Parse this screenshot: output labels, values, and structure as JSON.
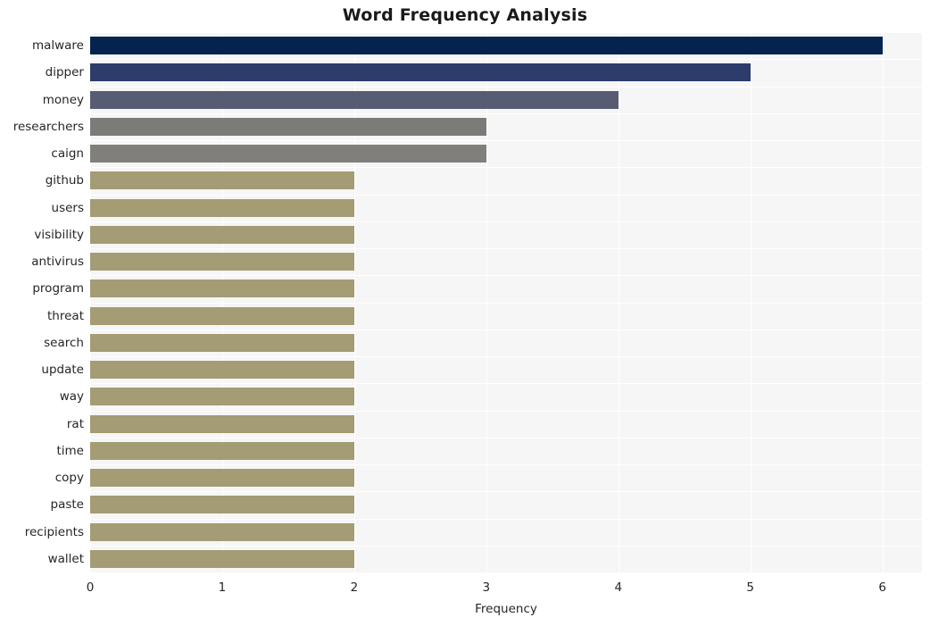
{
  "chart_data": {
    "type": "bar",
    "orientation": "horizontal",
    "title": "Word Frequency Analysis",
    "xlabel": "Frequency",
    "ylabel": "",
    "xlim": [
      0,
      6.3
    ],
    "xticks": [
      0,
      1,
      2,
      3,
      4,
      5,
      6
    ],
    "xtick_labels": [
      "0",
      "1",
      "2",
      "3",
      "4",
      "5",
      "6"
    ],
    "grid": true,
    "legend": null,
    "categories": [
      "malware",
      "dipper",
      "money",
      "researchers",
      "caign",
      "github",
      "users",
      "visibility",
      "antivirus",
      "program",
      "threat",
      "search",
      "update",
      "way",
      "rat",
      "time",
      "copy",
      "paste",
      "recipients",
      "wallet"
    ],
    "values": [
      6,
      5,
      4,
      3,
      3,
      2,
      2,
      2,
      2,
      2,
      2,
      2,
      2,
      2,
      2,
      2,
      2,
      2,
      2,
      2
    ],
    "bar_colors": [
      "#04244f",
      "#2d3c6b",
      "#585c73",
      "#7b7b78",
      "#807f7b",
      "#a39c74",
      "#a39c74",
      "#a39c74",
      "#a39c74",
      "#a39c74",
      "#a39c74",
      "#a39c74",
      "#a39c74",
      "#a39c74",
      "#a39c74",
      "#a39c74",
      "#a39c74",
      "#a39c74",
      "#a39c74",
      "#a39c74"
    ]
  },
  "style": {
    "plot_background": "#f6f6f7",
    "figure_background": "#ffffff",
    "gridline_color": "#ffffff",
    "text_color": "#262626",
    "title_color": "#1a1a1a"
  }
}
